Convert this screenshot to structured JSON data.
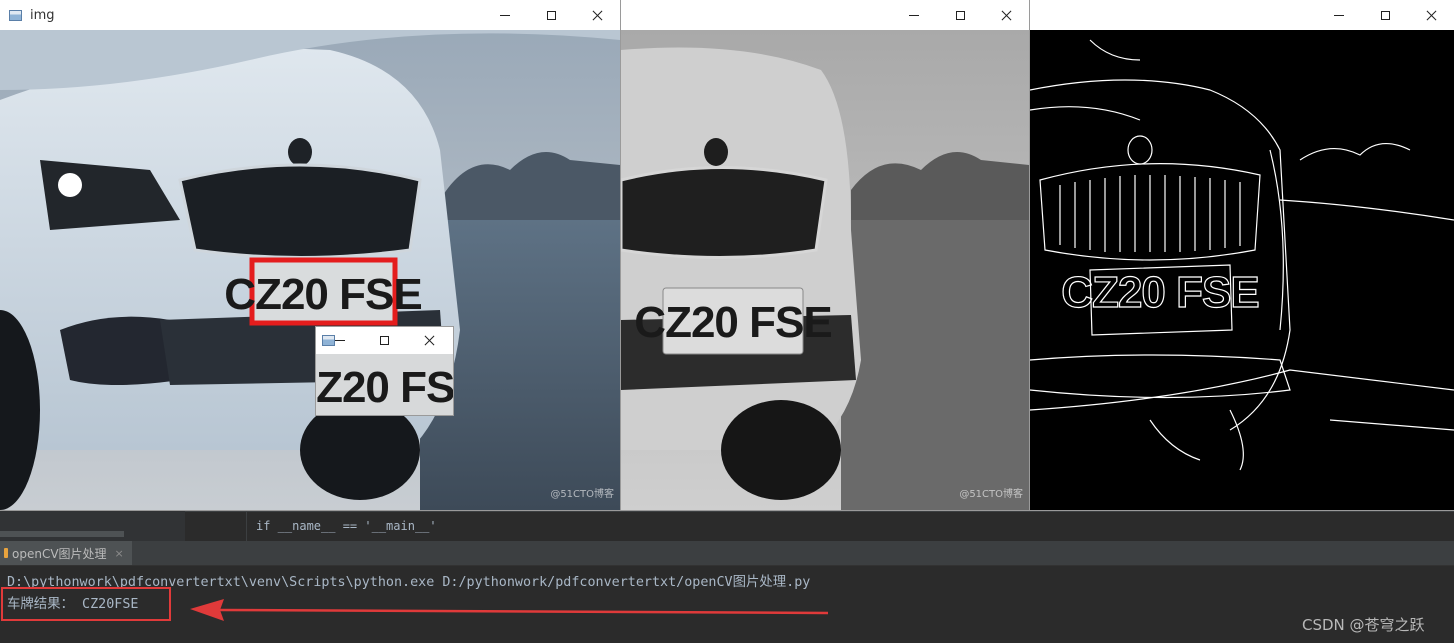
{
  "windows": {
    "original": {
      "title": "img"
    },
    "gray": {
      "title": ""
    },
    "edges": {
      "title": ""
    },
    "plate": {
      "title": ""
    }
  },
  "plate_text": "CZ20 FSE",
  "image_watermark": "@51CTO博客",
  "ide": {
    "code_line": "if __name__ == '__main__'",
    "run_tab_label": "openCV图片处理",
    "run_tab_close": "×"
  },
  "console": {
    "command": "D:\\pythonwork\\pdfconvertertxt\\venv\\Scripts\\python.exe D:/pythonwork/pdfconvertertxt/openCV图片处理.py",
    "result": "车牌结果： CZ20FSE"
  },
  "page_watermark": "CSDN @苍穹之跃",
  "colors": {
    "annotation_red": "#e03a3a",
    "console_text": "#a9b7c6"
  },
  "icons": [
    "window-app-icon",
    "minimize-icon",
    "maximize-icon",
    "close-icon",
    "run-config-icon",
    "arrow-icon"
  ]
}
